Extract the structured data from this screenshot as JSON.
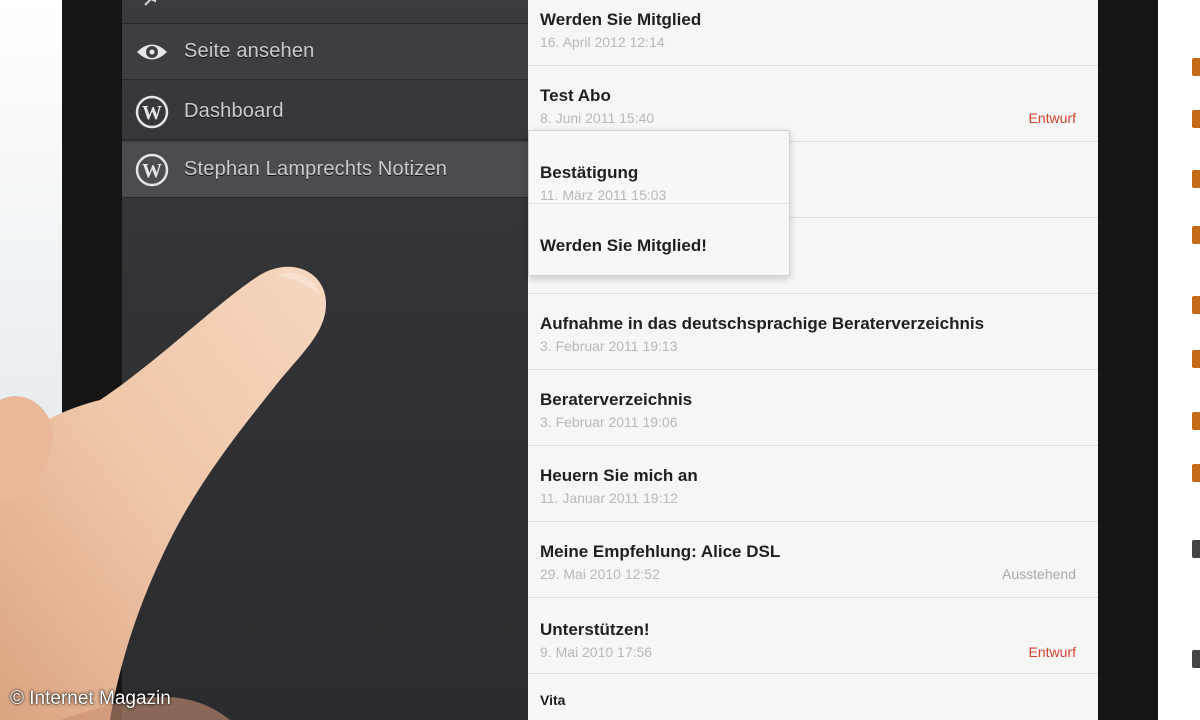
{
  "menu": {
    "items": [
      {
        "label": "",
        "icon": "pin-icon"
      },
      {
        "label": "Seite ansehen",
        "icon": "eye-icon"
      },
      {
        "label": "Dashboard",
        "icon": "wordpress-icon"
      },
      {
        "label": "Stephan Lamprechts Notizen",
        "icon": "wordpress-icon"
      }
    ]
  },
  "posts": [
    {
      "title": "Werden Sie Mitglied",
      "date": "16. April 2012 12:14",
      "status": ""
    },
    {
      "title": "Test Abo",
      "date": "8. Juni 2011 15:40",
      "status": "Entwurf"
    },
    {
      "title": "Aufnahme in das deutschsprachige Beraterverzeichnis",
      "date": "3. Februar 2011 19:13",
      "status": ""
    },
    {
      "title": "Beraterverzeichnis",
      "date": "3. Februar 2011 19:06",
      "status": ""
    },
    {
      "title": "Heuern Sie mich an",
      "date": "11. Januar 2011 19:12",
      "status": ""
    },
    {
      "title": "Meine Empfehlung: Alice DSL",
      "date": "29. Mai 2010 12:52",
      "status": "Ausstehend"
    },
    {
      "title": "Unterstützen!",
      "date": "9. Mai 2010 17:56",
      "status": "Entwurf"
    },
    {
      "title": "Vita",
      "date": "",
      "status": ""
    }
  ],
  "popover": {
    "items": [
      {
        "title": "Bestätigung",
        "date": "11. März 2011 15:03"
      },
      {
        "title": "Werden Sie Mitglied!",
        "date": ""
      }
    ]
  },
  "colors": {
    "menu_bg": "#323336",
    "list_bg": "#f6f6f6",
    "draft": "#d0452e",
    "pending": "#a9a9a9"
  },
  "credit": "© Internet Magazin"
}
